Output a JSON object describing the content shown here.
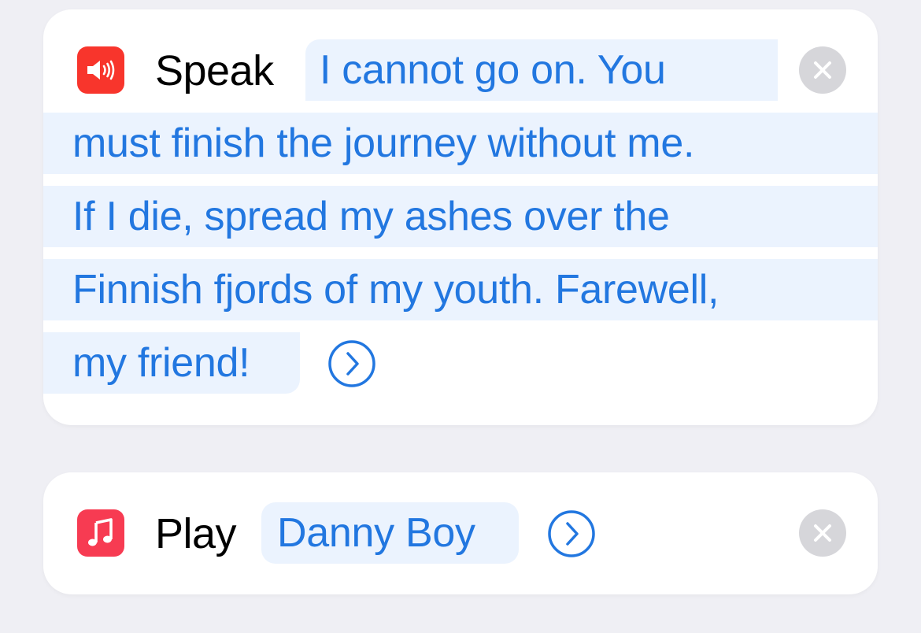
{
  "speak_action": {
    "icon": "speaker-icon",
    "icon_color": "#f8352c",
    "verb": "Speak",
    "text_lines": [
      "I cannot go on. You",
      "must finish the journey without me.",
      "If I die, spread my ashes over the",
      "Finnish fjords of my youth. Farewell,",
      "my friend!"
    ],
    "expand_icon": "chevron-right-circle-icon",
    "remove_icon": "close-icon"
  },
  "play_action": {
    "icon": "music-note-icon",
    "icon_color": "#f73b52",
    "verb": "Play",
    "song": "Danny Boy",
    "expand_icon": "chevron-right-circle-icon",
    "remove_icon": "close-icon"
  },
  "colors": {
    "background": "#efeff4",
    "card": "#ffffff",
    "token_bg": "#ebf3fe",
    "token_text": "#2277e0",
    "close_bg": "#d6d6da"
  }
}
